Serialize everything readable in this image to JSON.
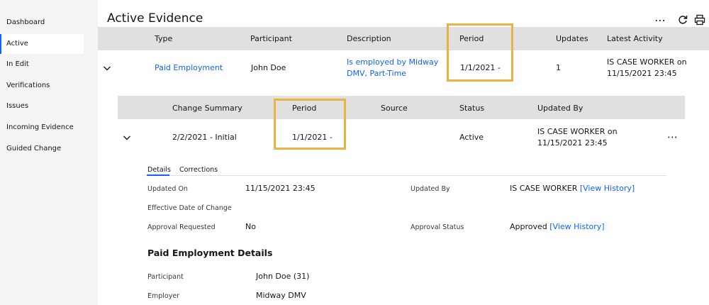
{
  "sidebar": {
    "items": [
      {
        "label": "Dashboard"
      },
      {
        "label": "Active"
      },
      {
        "label": "In Edit"
      },
      {
        "label": "Verifications"
      },
      {
        "label": "Issues"
      },
      {
        "label": "Incoming Evidence"
      },
      {
        "label": "Guided Change"
      }
    ],
    "active_index": 1
  },
  "page": {
    "title": "Active Evidence",
    "toolbar": {
      "more_glyph": "⋯",
      "refresh_icon": "refresh-icon",
      "print_icon": "printer-icon"
    }
  },
  "evidence_table": {
    "columns": [
      "Type",
      "Participant",
      "Description",
      "Period",
      "Updates",
      "Latest Activity"
    ],
    "row": {
      "type": "Paid Employment",
      "participant": "John Doe",
      "description_line1": "Is employed by Midway",
      "description_line2": "DMV, Part-Time",
      "period": "1/1/2021 -",
      "updates": "1",
      "latest_line1": "IS CASE WORKER on",
      "latest_line2": "11/15/2021 23:45"
    }
  },
  "change_table": {
    "columns": [
      "Change Summary",
      "Period",
      "Source",
      "Status",
      "Updated By"
    ],
    "row": {
      "summary": "2/2/2021 - Initial",
      "period": "1/1/2021 -",
      "source": "",
      "status": "Active",
      "updated_line1": "IS CASE WORKER on",
      "updated_line2": "11/15/2021 23:45",
      "more_glyph": "⋯"
    }
  },
  "details": {
    "tabs": [
      "Details",
      "Corrections"
    ],
    "active_tab": 0,
    "fields": {
      "updated_on_label": "Updated On",
      "updated_on_value": "11/15/2021 23:45",
      "updated_by_label": "Updated By",
      "updated_by_value": "IS CASE WORKER",
      "view_history_1": "[View History]",
      "effective_label": "Effective Date of Change",
      "approval_req_label": "Approval Requested",
      "approval_req_value": "No",
      "approval_status_label": "Approval Status",
      "approval_status_value": "Approved",
      "view_history_2": "[View History]"
    },
    "section_title": "Paid Employment Details",
    "employment": {
      "participant_label": "Participant",
      "participant_value": "John Doe (31)",
      "employer_label": "Employer",
      "employer_value": "Midway DMV"
    }
  },
  "colors": {
    "accent": "#0f62fe",
    "highlight": "#e8b341",
    "header_band": "#e0e0e0",
    "sidebar_bg": "#f4f4f4"
  }
}
